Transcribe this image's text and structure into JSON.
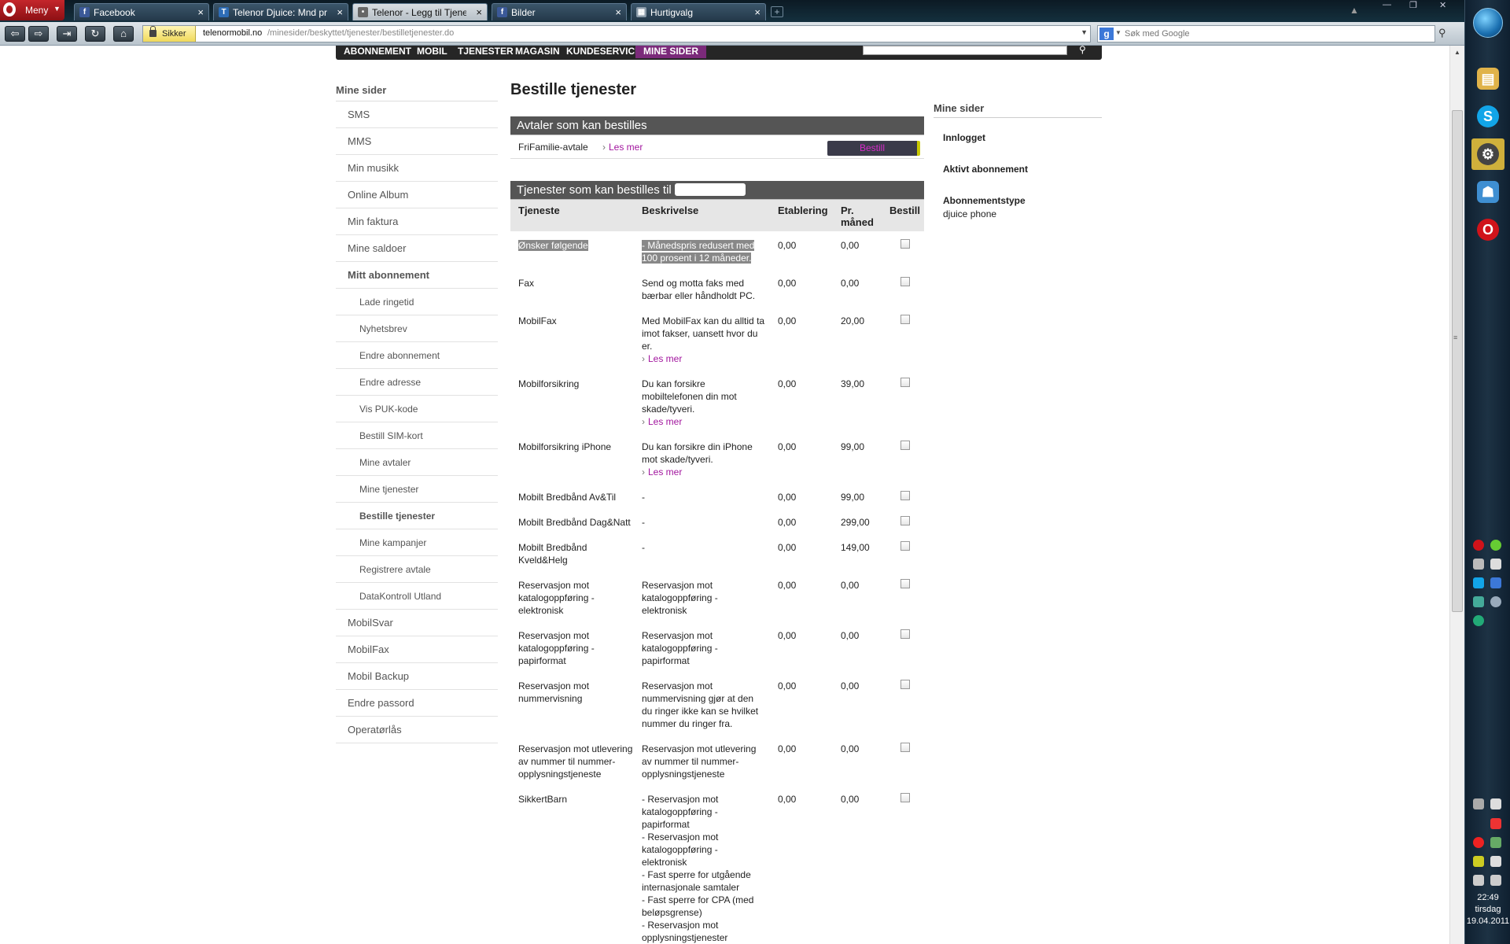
{
  "browser": {
    "menu_label": "Meny",
    "tabs": [
      {
        "title": "Facebook",
        "icon": "facebook-icon",
        "close": "×"
      },
      {
        "title": "Telenor Djuice: Mnd pr...",
        "icon": "telenor-icon",
        "close": "×"
      },
      {
        "title": "Telenor - Legg til Tjene...",
        "icon": "telenor-icon",
        "close": "×"
      },
      {
        "title": "Bilder",
        "icon": "facebook-icon",
        "close": "×"
      },
      {
        "title": "Hurtigvalg",
        "icon": "speed-dial-icon",
        "close": "×"
      }
    ],
    "security_label": "Sikker",
    "url_host": "telenormobil.no",
    "url_path": "/minesider/beskyttet/tjenester/bestilletjenester.do",
    "search_placeholder": "Søk med Google"
  },
  "site": {
    "topnav": [
      "Abonnement",
      "Mobil",
      "Tjenester",
      "Magasin",
      "Kundeservice",
      "Mine sider"
    ],
    "active_topnav": "Mine sider"
  },
  "sidebar": {
    "heading": "Mine sider",
    "items": [
      {
        "label": "SMS",
        "level": 1
      },
      {
        "label": "MMS",
        "level": 1
      },
      {
        "label": "Min musikk",
        "level": 1
      },
      {
        "label": "Online Album",
        "level": 1
      },
      {
        "label": "Min faktura",
        "level": 1
      },
      {
        "label": "Mine saldoer",
        "level": 1
      },
      {
        "label": "Mitt abonnement",
        "level": 1
      },
      {
        "label": "Lade ringetid",
        "level": 2
      },
      {
        "label": "Nyhetsbrev",
        "level": 2
      },
      {
        "label": "Endre abonnement",
        "level": 2
      },
      {
        "label": "Endre adresse",
        "level": 2
      },
      {
        "label": "Vis PUK-kode",
        "level": 2
      },
      {
        "label": "Bestill SIM-kort",
        "level": 2
      },
      {
        "label": "Mine avtaler",
        "level": 2
      },
      {
        "label": "Mine tjenester",
        "level": 2
      },
      {
        "label": "Bestille tjenester",
        "level": 2
      },
      {
        "label": "Mine kampanjer",
        "level": 2
      },
      {
        "label": "Registrere avtale",
        "level": 2
      },
      {
        "label": "DataKontroll Utland",
        "level": 2
      },
      {
        "label": "MobilSvar",
        "level": 1
      },
      {
        "label": "MobilFax",
        "level": 1
      },
      {
        "label": "Mobil Backup",
        "level": 1
      },
      {
        "label": "Endre passord",
        "level": 1
      },
      {
        "label": "Operatørlås",
        "level": 1
      }
    ]
  },
  "main": {
    "title": "Bestille tjenester",
    "agreements_heading": "Avtaler som kan bestilles",
    "agreement": {
      "name": "FriFamilie-avtale",
      "more": "Les mer",
      "button": "Bestill"
    },
    "services_heading": "Tjenester som kan bestilles til",
    "columns": [
      "Tjeneste",
      "Beskrivelse",
      "Etablering",
      "Pr. måned",
      "Bestill"
    ],
    "rows": [
      {
        "name": "Ønsker følgende",
        "desc": "- Månedspris redusert med 100 prosent i 12 måneder.",
        "est": "0,00",
        "pm": "0,00",
        "highlight": true
      },
      {
        "name": "Fax",
        "desc": "Send og motta faks med bærbar eller håndholdt PC.",
        "est": "0,00",
        "pm": "0,00"
      },
      {
        "name": "MobilFax",
        "desc": "Med MobilFax kan du alltid ta imot fakser, uansett hvor du er.",
        "more": "Les mer",
        "est": "0,00",
        "pm": "20,00"
      },
      {
        "name": "Mobilforsikring",
        "desc": "Du kan forsikre mobiltelefonen din mot skade/tyveri.",
        "more": "Les mer",
        "est": "0,00",
        "pm": "39,00"
      },
      {
        "name": "Mobilforsikring iPhone",
        "desc": "Du kan forsikre din iPhone mot skade/tyveri.",
        "more": "Les mer",
        "est": "0,00",
        "pm": "99,00"
      },
      {
        "name": "Mobilt Bredbånd Av&Til",
        "desc": "-",
        "est": "0,00",
        "pm": "99,00"
      },
      {
        "name": "Mobilt Bredbånd Dag&Natt",
        "desc": "-",
        "est": "0,00",
        "pm": "299,00"
      },
      {
        "name": "Mobilt Bredbånd Kveld&Helg",
        "desc": "-",
        "est": "0,00",
        "pm": "149,00"
      },
      {
        "name": "Reservasjon mot katalogoppføring - elektronisk",
        "desc": "Reservasjon mot katalogoppføring - elektronisk",
        "est": "0,00",
        "pm": "0,00"
      },
      {
        "name": "Reservasjon mot katalogoppføring - papirformat",
        "desc": "Reservasjon mot katalogoppføring - papirformat",
        "est": "0,00",
        "pm": "0,00"
      },
      {
        "name": "Reservasjon mot nummervisning",
        "desc": "Reservasjon mot nummervisning gjør at den du ringer ikke kan se hvilket nummer du ringer fra.",
        "est": "0,00",
        "pm": "0,00"
      },
      {
        "name": "Reservasjon mot utlevering av nummer til nummer-opplysningstjeneste",
        "desc": "Reservasjon mot utlevering av nummer til nummer-opplysningstjeneste",
        "est": "0,00",
        "pm": "0,00"
      },
      {
        "name": "SikkertBarn",
        "desc": "- Reservasjon mot katalogoppføring - papirformat\n- Reservasjon mot katalogoppføring - elektronisk\n- Fast sperre for utgående internasjonale samtaler\n- Fast sperre for CPA (med beløpsgrense)\n- Reservasjon mot opplysningstjenester\n- Fast sperre for GPRS",
        "est": "0,00",
        "pm": "0,00"
      }
    ]
  },
  "right": {
    "heading": "Mine sider",
    "logged_in_label": "Innlogget",
    "active_sub_label": "Aktivt abonnement",
    "sub_type_label": "Abonnementstype",
    "sub_type_value": "djuice phone"
  },
  "taskbar": {
    "time": "22:49",
    "day": "tirsdag",
    "date": "19.04.2011"
  },
  "colors": {
    "brand_purple": "#a2159e",
    "nav_active": "#7b2a7a",
    "section_head": "#555555"
  }
}
